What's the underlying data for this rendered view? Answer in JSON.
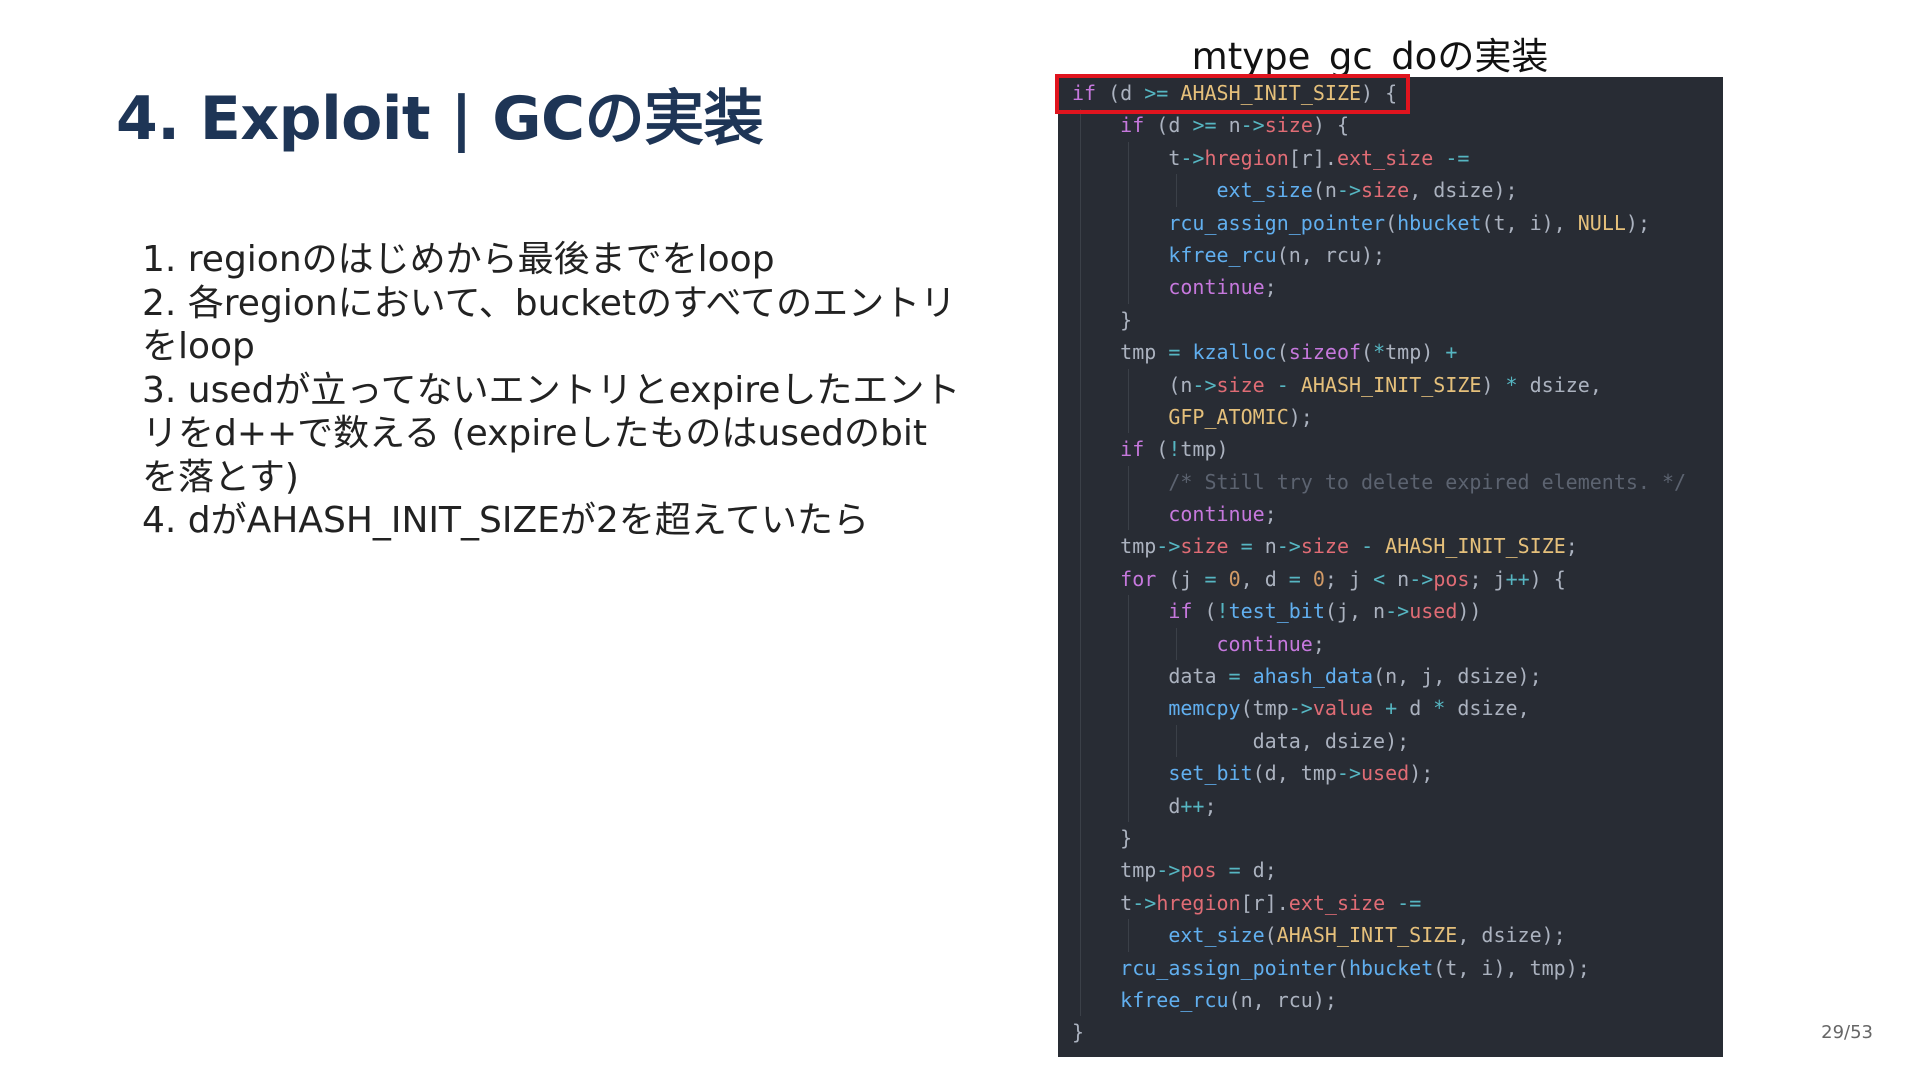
{
  "slide": {
    "title": "4. Exploit | GCの実装",
    "steps": [
      "1. regionのはじめから最後までをloop",
      "2. 各regionにおいて、bucketのすべてのエントリをloop",
      "3. usedが立ってないエントリとexpireしたエントリをd++で数える (expireしたものはusedのbitを落とす)",
      "4. dがAHASH_INIT_SIZEが2を超えていたら"
    ],
    "page_number": "29/53"
  },
  "code": {
    "caption": "mtype_gc_doの実装",
    "highlight_color": "#e0141e",
    "lines": [
      {
        "indent": 0,
        "tokens": [
          {
            "t": "if",
            "c": "kw"
          },
          {
            "t": " (d "
          },
          {
            "t": ">=",
            "c": "op"
          },
          {
            "t": " "
          },
          {
            "t": "AHASH_INIT_SIZE",
            "c": "cst"
          },
          {
            "t": ") {"
          }
        ]
      },
      {
        "indent": 1,
        "tokens": [
          {
            "t": "if",
            "c": "kw"
          },
          {
            "t": " (d "
          },
          {
            "t": ">=",
            "c": "op"
          },
          {
            "t": " n"
          },
          {
            "t": "->",
            "c": "op"
          },
          {
            "t": "size",
            "c": "fld"
          },
          {
            "t": ") {"
          }
        ]
      },
      {
        "indent": 2,
        "tokens": [
          {
            "t": "t"
          },
          {
            "t": "->",
            "c": "op"
          },
          {
            "t": "hregion",
            "c": "fld"
          },
          {
            "t": "[r]."
          },
          {
            "t": "ext_size",
            "c": "fld"
          },
          {
            "t": " "
          },
          {
            "t": "-=",
            "c": "op"
          }
        ]
      },
      {
        "indent": 3,
        "tokens": [
          {
            "t": "ext_size",
            "c": "fn"
          },
          {
            "t": "(n"
          },
          {
            "t": "->",
            "c": "op"
          },
          {
            "t": "size",
            "c": "fld"
          },
          {
            "t": ", dsize);"
          }
        ]
      },
      {
        "indent": 2,
        "tokens": [
          {
            "t": "rcu_assign_pointer",
            "c": "fn"
          },
          {
            "t": "("
          },
          {
            "t": "hbucket",
            "c": "fn"
          },
          {
            "t": "(t, i), "
          },
          {
            "t": "NULL",
            "c": "cst"
          },
          {
            "t": ");"
          }
        ]
      },
      {
        "indent": 2,
        "tokens": [
          {
            "t": "kfree_rcu",
            "c": "fn"
          },
          {
            "t": "(n, rcu);"
          }
        ]
      },
      {
        "indent": 2,
        "tokens": [
          {
            "t": "continue",
            "c": "kw"
          },
          {
            "t": ";"
          }
        ]
      },
      {
        "indent": 1,
        "tokens": [
          {
            "t": "}"
          }
        ]
      },
      {
        "indent": 1,
        "tokens": [
          {
            "t": "tmp "
          },
          {
            "t": "=",
            "c": "op"
          },
          {
            "t": " "
          },
          {
            "t": "kzalloc",
            "c": "fn"
          },
          {
            "t": "("
          },
          {
            "t": "sizeof",
            "c": "kw"
          },
          {
            "t": "("
          },
          {
            "t": "*",
            "c": "op"
          },
          {
            "t": "tmp) "
          },
          {
            "t": "+",
            "c": "op"
          }
        ]
      },
      {
        "indent": 2,
        "tokens": [
          {
            "t": "(n"
          },
          {
            "t": "->",
            "c": "op"
          },
          {
            "t": "size",
            "c": "fld"
          },
          {
            "t": " "
          },
          {
            "t": "-",
            "c": "op"
          },
          {
            "t": " "
          },
          {
            "t": "AHASH_INIT_SIZE",
            "c": "cst"
          },
          {
            "t": ") "
          },
          {
            "t": "*",
            "c": "op"
          },
          {
            "t": " dsize,"
          }
        ]
      },
      {
        "indent": 2,
        "tokens": [
          {
            "t": "GFP_ATOMIC",
            "c": "cst"
          },
          {
            "t": ");"
          }
        ]
      },
      {
        "indent": 1,
        "tokens": [
          {
            "t": "if",
            "c": "kw"
          },
          {
            "t": " ("
          },
          {
            "t": "!",
            "c": "op"
          },
          {
            "t": "tmp)"
          }
        ]
      },
      {
        "indent": 2,
        "tokens": [
          {
            "t": "/* Still try to delete expired elements. */",
            "c": "cmt"
          }
        ]
      },
      {
        "indent": 2,
        "tokens": [
          {
            "t": "continue",
            "c": "kw"
          },
          {
            "t": ";"
          }
        ]
      },
      {
        "indent": 1,
        "tokens": [
          {
            "t": "tmp"
          },
          {
            "t": "->",
            "c": "op"
          },
          {
            "t": "size",
            "c": "fld"
          },
          {
            "t": " "
          },
          {
            "t": "=",
            "c": "op"
          },
          {
            "t": " n"
          },
          {
            "t": "->",
            "c": "op"
          },
          {
            "t": "size",
            "c": "fld"
          },
          {
            "t": " "
          },
          {
            "t": "-",
            "c": "op"
          },
          {
            "t": " "
          },
          {
            "t": "AHASH_INIT_SIZE",
            "c": "cst"
          },
          {
            "t": ";"
          }
        ]
      },
      {
        "indent": 1,
        "tokens": [
          {
            "t": "for",
            "c": "kw"
          },
          {
            "t": " (j "
          },
          {
            "t": "=",
            "c": "op"
          },
          {
            "t": " "
          },
          {
            "t": "0",
            "c": "num"
          },
          {
            "t": ", d "
          },
          {
            "t": "=",
            "c": "op"
          },
          {
            "t": " "
          },
          {
            "t": "0",
            "c": "num"
          },
          {
            "t": "; j "
          },
          {
            "t": "<",
            "c": "op"
          },
          {
            "t": " n"
          },
          {
            "t": "->",
            "c": "op"
          },
          {
            "t": "pos",
            "c": "fld"
          },
          {
            "t": "; j"
          },
          {
            "t": "++",
            "c": "op"
          },
          {
            "t": ") {"
          }
        ]
      },
      {
        "indent": 2,
        "tokens": [
          {
            "t": "if",
            "c": "kw"
          },
          {
            "t": " ("
          },
          {
            "t": "!",
            "c": "op"
          },
          {
            "t": "test_bit",
            "c": "fn"
          },
          {
            "t": "(j, n"
          },
          {
            "t": "->",
            "c": "op"
          },
          {
            "t": "used",
            "c": "fld"
          },
          {
            "t": "))"
          }
        ]
      },
      {
        "indent": 3,
        "tokens": [
          {
            "t": "continue",
            "c": "kw"
          },
          {
            "t": ";"
          }
        ]
      },
      {
        "indent": 2,
        "tokens": [
          {
            "t": "data "
          },
          {
            "t": "=",
            "c": "op"
          },
          {
            "t": " "
          },
          {
            "t": "ahash_data",
            "c": "fn"
          },
          {
            "t": "(n, j, dsize);"
          }
        ]
      },
      {
        "indent": 2,
        "tokens": [
          {
            "t": "memcpy",
            "c": "fn"
          },
          {
            "t": "(tmp"
          },
          {
            "t": "->",
            "c": "op"
          },
          {
            "t": "value",
            "c": "fld"
          },
          {
            "t": " "
          },
          {
            "t": "+",
            "c": "op"
          },
          {
            "t": " d "
          },
          {
            "t": "*",
            "c": "op"
          },
          {
            "t": " dsize,"
          }
        ]
      },
      {
        "indent": 3,
        "pad": 3,
        "tokens": [
          {
            "t": "data, dsize);"
          }
        ]
      },
      {
        "indent": 2,
        "tokens": [
          {
            "t": "set_bit",
            "c": "fn"
          },
          {
            "t": "(d, tmp"
          },
          {
            "t": "->",
            "c": "op"
          },
          {
            "t": "used",
            "c": "fld"
          },
          {
            "t": ");"
          }
        ]
      },
      {
        "indent": 2,
        "tokens": [
          {
            "t": "d"
          },
          {
            "t": "++",
            "c": "op"
          },
          {
            "t": ";"
          }
        ]
      },
      {
        "indent": 1,
        "tokens": [
          {
            "t": "}"
          }
        ]
      },
      {
        "indent": 1,
        "tokens": [
          {
            "t": "tmp"
          },
          {
            "t": "->",
            "c": "op"
          },
          {
            "t": "pos",
            "c": "fld"
          },
          {
            "t": " "
          },
          {
            "t": "=",
            "c": "op"
          },
          {
            "t": " d;"
          }
        ]
      },
      {
        "indent": 1,
        "tokens": [
          {
            "t": "t"
          },
          {
            "t": "->",
            "c": "op"
          },
          {
            "t": "hregion",
            "c": "fld"
          },
          {
            "t": "[r]."
          },
          {
            "t": "ext_size",
            "c": "fld"
          },
          {
            "t": " "
          },
          {
            "t": "-=",
            "c": "op"
          }
        ]
      },
      {
        "indent": 2,
        "tokens": [
          {
            "t": "ext_size",
            "c": "fn"
          },
          {
            "t": "("
          },
          {
            "t": "AHASH_INIT_SIZE",
            "c": "cst"
          },
          {
            "t": ", dsize);"
          }
        ]
      },
      {
        "indent": 1,
        "tokens": [
          {
            "t": "rcu_assign_pointer",
            "c": "fn"
          },
          {
            "t": "("
          },
          {
            "t": "hbucket",
            "c": "fn"
          },
          {
            "t": "(t, i), tmp);"
          }
        ]
      },
      {
        "indent": 1,
        "tokens": [
          {
            "t": "kfree_rcu",
            "c": "fn"
          },
          {
            "t": "(n, rcu);"
          }
        ]
      },
      {
        "indent": 0,
        "tokens": [
          {
            "t": "}"
          }
        ]
      }
    ]
  }
}
